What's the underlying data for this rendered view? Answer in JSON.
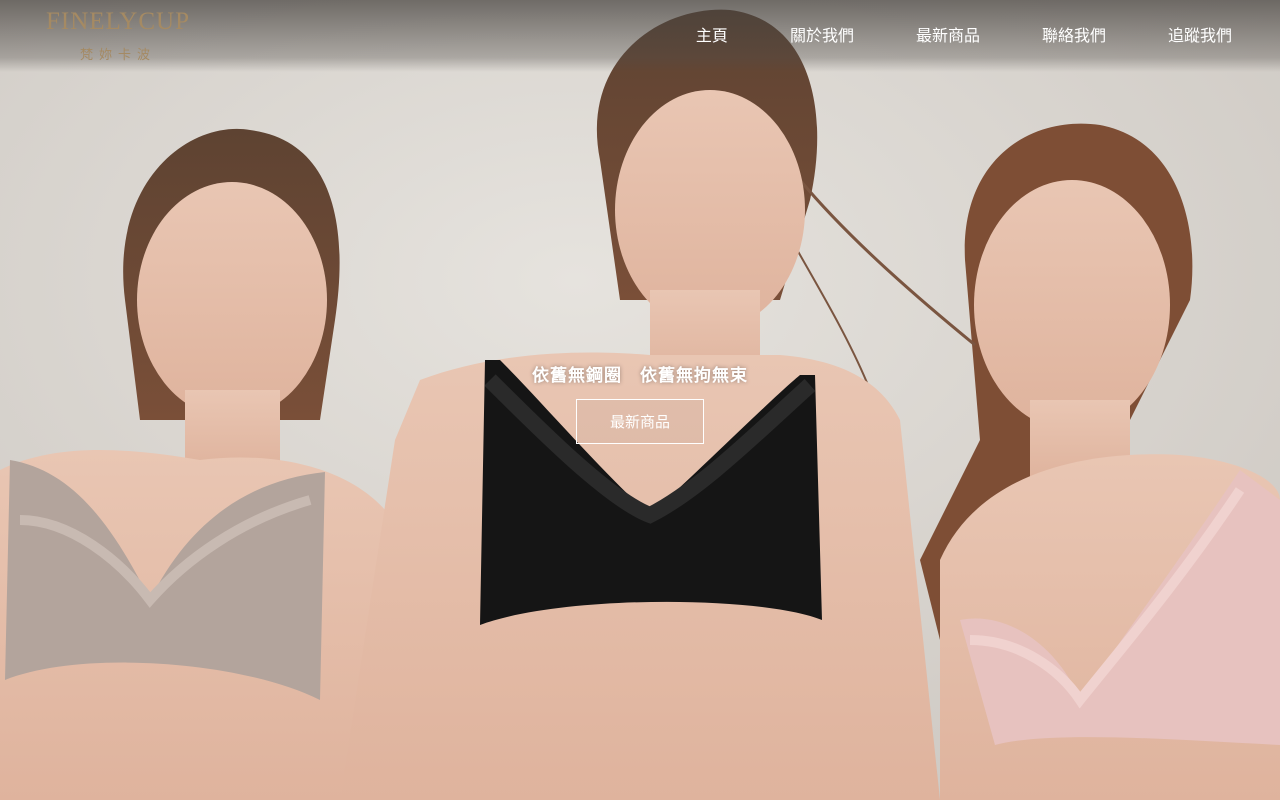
{
  "logo": {
    "main": "FINELYCUP",
    "sub": "梵妳卡波"
  },
  "nav": {
    "items": [
      {
        "label": "主頁"
      },
      {
        "label": "關於我們"
      },
      {
        "label": "最新商品"
      },
      {
        "label": "聯絡我們"
      },
      {
        "label": "追蹤我們"
      }
    ]
  },
  "hero": {
    "tagline": "依舊無鋼圈　依舊無拘無束",
    "button_label": "最新商品"
  },
  "colors": {
    "logo_gold": "#a58a63",
    "nav_text": "#ffffff",
    "background": "#d9d6d1"
  }
}
